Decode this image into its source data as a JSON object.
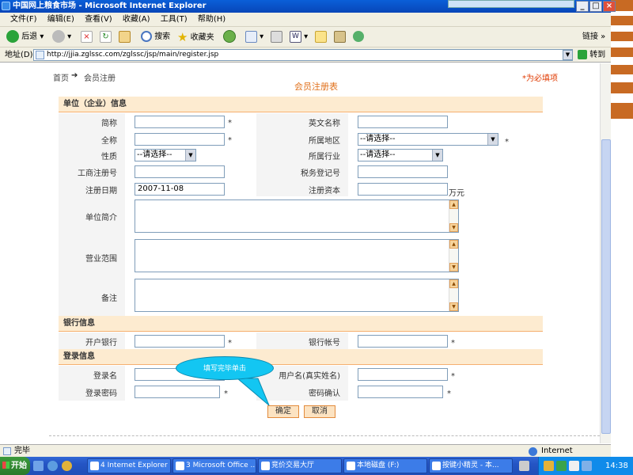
{
  "window": {
    "title": "中国网上粮食市场 - Microsoft Internet Explorer"
  },
  "menu": [
    "文件(F)",
    "编辑(E)",
    "查看(V)",
    "收藏(A)",
    "工具(T)",
    "帮助(H)"
  ],
  "toolbar": {
    "back": "后退",
    "search": "搜索",
    "favorites": "收藏夹",
    "links": "链接"
  },
  "address": {
    "label": "地址(D)",
    "url": "http://jjia.zglssc.com/zglssc/jsp/main/register.jsp",
    "go": "转到"
  },
  "page": {
    "breadcrumb_home": "首页",
    "breadcrumb_arrow": "➔",
    "breadcrumb_current": "会员注册",
    "title": "会员注册表",
    "required_note": "*为必填项",
    "sections": {
      "company": "单位（企业）信息",
      "bank": "银行信息",
      "login": "登录信息"
    },
    "company": {
      "short_name": "简称",
      "english_name": "英文名称",
      "full_name": "全称",
      "region": "所属地区",
      "region_value": "--请选择--",
      "nature": "性质",
      "nature_value": "--请选择--",
      "industry": "所属行业",
      "industry_value": "--请选择--",
      "business_reg_no": "工商注册号",
      "tax_reg_no": "税务登记号",
      "reg_date": "注册日期",
      "reg_date_value": "2007-11-08",
      "reg_capital": "注册资本",
      "capital_unit": "万元",
      "intro": "单位简介",
      "scope": "营业范围",
      "remark": "备注"
    },
    "bank": {
      "bank_name": "开户银行",
      "account": "银行帐号"
    },
    "login": {
      "login_name": "登录名",
      "username": "用户名(真实姓名)",
      "password": "登录密码",
      "confirm_password": "密码确认"
    },
    "star": "*",
    "confirm_button": "确定",
    "cancel_button": "取消",
    "callout": "填写完毕单击"
  },
  "status": {
    "left": "完毕",
    "zone": "Internet"
  },
  "taskbar": {
    "start": "开始",
    "tasks": [
      "4 Internet Explorer",
      "3 Microsoft Office ...",
      "竞价交易大厅",
      "本地磁盘 (F:)",
      "按键小精灵 - 本..."
    ],
    "clock": "14:38"
  }
}
